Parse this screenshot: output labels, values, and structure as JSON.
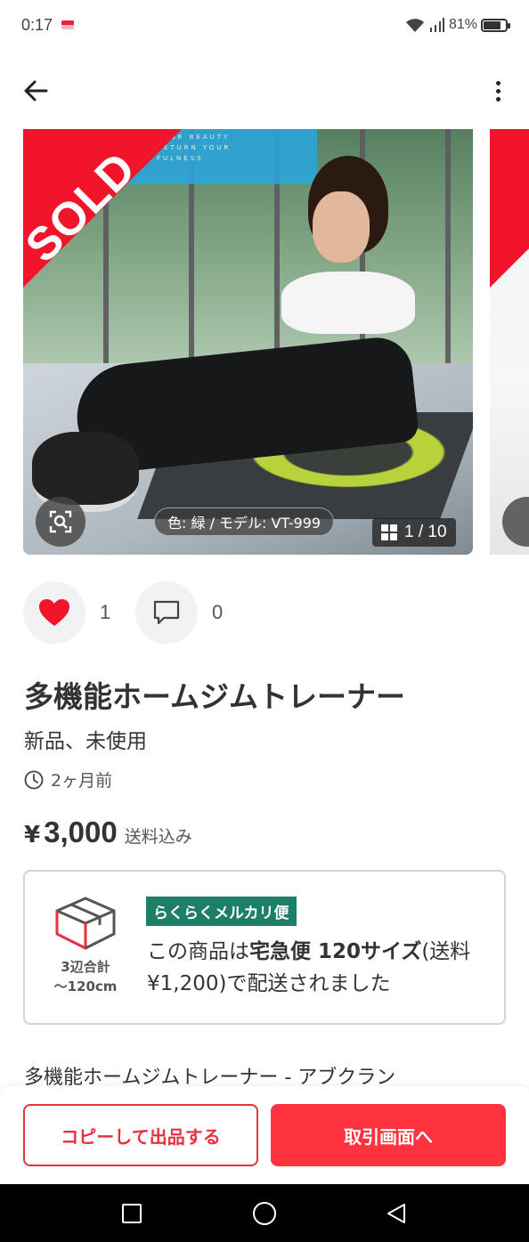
{
  "status_bar": {
    "time": "0:17",
    "battery": "81%",
    "battery_level": 0.81
  },
  "gallery": {
    "sold_label": "SOLD",
    "banner_text": "YOUR BEAUTY RETURN YOUR FULNESS",
    "variant_caption": "色: 緑 / モデル: VT-999",
    "counter": "1 / 10"
  },
  "actions": {
    "like_count": "1",
    "comment_count": "0",
    "like_color": "#f2142b"
  },
  "product": {
    "title": "多機能ホームジムトレーナー",
    "condition": "新品、未使用",
    "listed_ago": "2ヶ月前",
    "currency": "¥",
    "price": "3,000",
    "shipping_included": "送料込み"
  },
  "shipping": {
    "tag": "らくらくメルカリ便",
    "size_caption_line1": "3辺合計",
    "size_caption_line2": "〜120cm",
    "text_pre": "この商品は",
    "text_bold": "宅急便 120サイズ",
    "text_post": "(送料 ¥1,200)で配送されました",
    "tag_color": "#1e7f68"
  },
  "description_preview": "多機能ホームジムトレーナー - アブクラン",
  "bottom": {
    "copy_label": "コピーして出品する",
    "trade_label": "取引画面へ",
    "accent": "#ff333f"
  }
}
